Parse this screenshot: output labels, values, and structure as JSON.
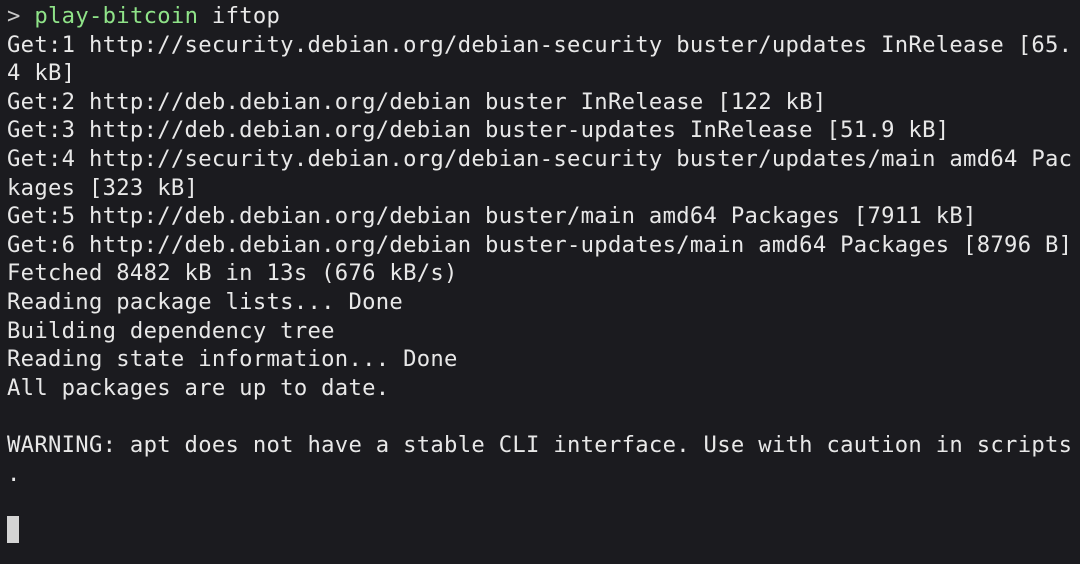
{
  "prompt": {
    "marker": ">",
    "directory": "play-bitcoin",
    "command": "iftop"
  },
  "output": {
    "lines": [
      "Get:1 http://security.debian.org/debian-security buster/updates InRelease [65.",
      "4 kB]",
      "Get:2 http://deb.debian.org/debian buster InRelease [122 kB]",
      "Get:3 http://deb.debian.org/debian buster-updates InRelease [51.9 kB]",
      "Get:4 http://security.debian.org/debian-security buster/updates/main amd64 Pac",
      "kages [323 kB]",
      "Get:5 http://deb.debian.org/debian buster/main amd64 Packages [7911 kB]",
      "Get:6 http://deb.debian.org/debian buster-updates/main amd64 Packages [8796 B]",
      "Fetched 8482 kB in 13s (676 kB/s)",
      "Reading package lists... Done",
      "Building dependency tree",
      "Reading state information... Done",
      "All packages are up to date.",
      "",
      "WARNING: apt does not have a stable CLI interface. Use with caution in scripts",
      "."
    ]
  },
  "colors": {
    "background": "#1b1b1f",
    "text": "#e8e8e8",
    "prompt_directory": "#8fe388",
    "cursor": "#d4d4d4"
  }
}
